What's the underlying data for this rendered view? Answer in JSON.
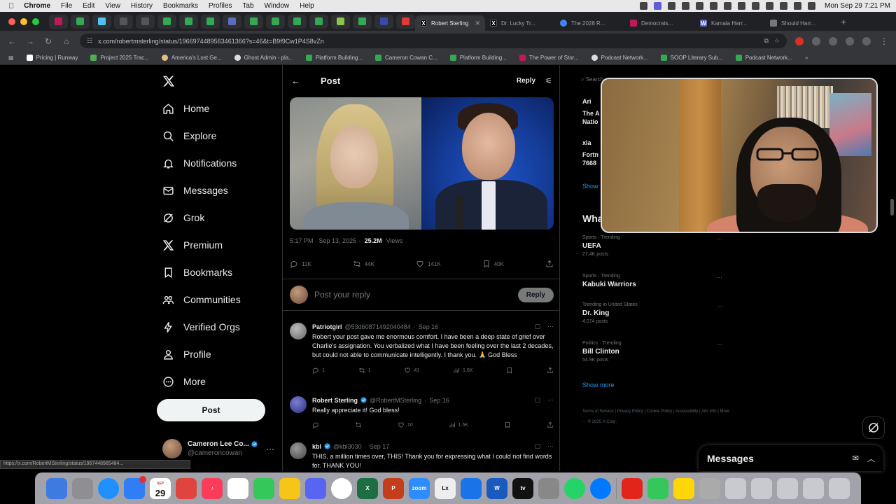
{
  "menubar": {
    "app": "Chrome",
    "items": [
      "File",
      "Edit",
      "View",
      "History",
      "Bookmarks",
      "Profiles",
      "Tab",
      "Window",
      "Help"
    ],
    "clock": "Mon Sep 29  7:21 PM"
  },
  "tabs": [
    {
      "label": "Robert Sterling",
      "favicon": "x-logo",
      "active": true
    },
    {
      "label": "Dr. Lucky Tr...",
      "favicon": "x-logo",
      "active": false
    },
    {
      "label": "The 2028 R...",
      "favicon": "globe-icon",
      "active": false
    },
    {
      "label": "Democrats...",
      "favicon": "red-square",
      "active": false
    },
    {
      "label": "Kamala Harr...",
      "favicon": "wiki-icon",
      "active": false
    },
    {
      "label": "Should Harr...",
      "favicon": "page-icon",
      "active": false
    }
  ],
  "omnibox": {
    "url": "x.com/robertmsterling/status/1966974489563461366?s=46&t=B9f9Cw1P4S8vZn"
  },
  "bookmarks": [
    "Pricing | Runway",
    "Project 2025 Trac...",
    "America's Lost Ge...",
    "Ghost Admin - pla...",
    "Platform Building...",
    "Cameron Cowan C...",
    "Platform Building...",
    "The Power of Stor...",
    "Podcast Network...",
    "SOOP Literary Sub...",
    "Podcast Network..."
  ],
  "nav": {
    "items": [
      {
        "label": "Home",
        "icon": "home-icon"
      },
      {
        "label": "Explore",
        "icon": "search-icon"
      },
      {
        "label": "Notifications",
        "icon": "bell-icon"
      },
      {
        "label": "Messages",
        "icon": "mail-icon"
      },
      {
        "label": "Grok",
        "icon": "grok-icon"
      },
      {
        "label": "Premium",
        "icon": "x-icon"
      },
      {
        "label": "Bookmarks",
        "icon": "bookmark-icon"
      },
      {
        "label": "Communities",
        "icon": "people-icon"
      },
      {
        "label": "Verified Orgs",
        "icon": "bolt-icon"
      },
      {
        "label": "Profile",
        "icon": "person-icon"
      },
      {
        "label": "More",
        "icon": "more-circle-icon"
      }
    ],
    "post_label": "Post",
    "account": {
      "name": "Cameron Lee Co...",
      "handle": "@cameroncowan"
    }
  },
  "status_url": "https://x.com/RobertMSterling/status/1967448965484...",
  "post": {
    "header_title": "Post",
    "reply_label": "Reply",
    "timestamp": "5:17 PM · Sep 13, 2025 ·",
    "views_count": "25.2M",
    "views_label": "Views",
    "stats": {
      "replies": "11K",
      "reposts": "44K",
      "likes": "141K",
      "bookmarks": "40K"
    }
  },
  "composer": {
    "placeholder": "Post your reply",
    "button": "Reply"
  },
  "replies": [
    {
      "name": "Patriotgirl",
      "handle": "@53d60871492040484",
      "date": "Sep 16",
      "verified": false,
      "text": "Robert your post gave me enormous comfort. I have been a deep state of grief over Charlie's assignation.  You verbalized what I have been feeling over the last 2 decades, but could not able to communicate intelligently. I thank you. 🙏 God Bless",
      "stats": {
        "replies": "1",
        "reposts": "1",
        "likes": "41",
        "views": "1.6K"
      }
    },
    {
      "name": "Robert Sterling",
      "handle": "@RobertMSterling",
      "date": "Sep 16",
      "verified": true,
      "text": "Really appreciate it! God bless!",
      "stats": {
        "replies": "",
        "reposts": "",
        "likes": "10",
        "views": "1.5K"
      }
    },
    {
      "name": "kbl",
      "handle": "@kbl3030",
      "date": "Sep 17",
      "verified": true,
      "text": "THIS, a million times over, THIS!  Thank you for expressing what I could not find words for. THANK YOU!",
      "stats": {
        "replies": "",
        "reposts": "",
        "likes": "",
        "views": ""
      }
    }
  ],
  "sidebar": {
    "search_peek": "Search",
    "peek_lines": [
      "Ari",
      "The A",
      "Natio",
      "xla",
      "Fortn",
      "7668",
      "Show"
    ],
    "whats_peek": "Wha",
    "trends": [
      {
        "category": "Sports · Trending",
        "name": "UEFA",
        "posts": "27.4K posts"
      },
      {
        "category": "Sports · Trending",
        "name": "Kabuki Warriors",
        "posts": ""
      },
      {
        "category": "Trending in United States",
        "name": "Dr. King",
        "posts": "4,074 posts"
      },
      {
        "category": "Politics · Trending",
        "name": "Bill Clinton",
        "posts": "54.9K posts"
      }
    ],
    "show_more": "Show more",
    "footer": "Terms of Service  |  Privacy Policy  |  Cookie Policy  |  Accessibility  |  Ads info  |  More ···  © 2025 X Corp."
  },
  "messages_drawer": {
    "title": "Messages"
  },
  "dock": {
    "calendar_month": "SEP",
    "calendar_day": "29"
  },
  "colors": {
    "accent": "#1d9bf0",
    "background": "#000000",
    "text": "#e7e9ea",
    "muted": "#71767b",
    "border": "#2f3336"
  }
}
